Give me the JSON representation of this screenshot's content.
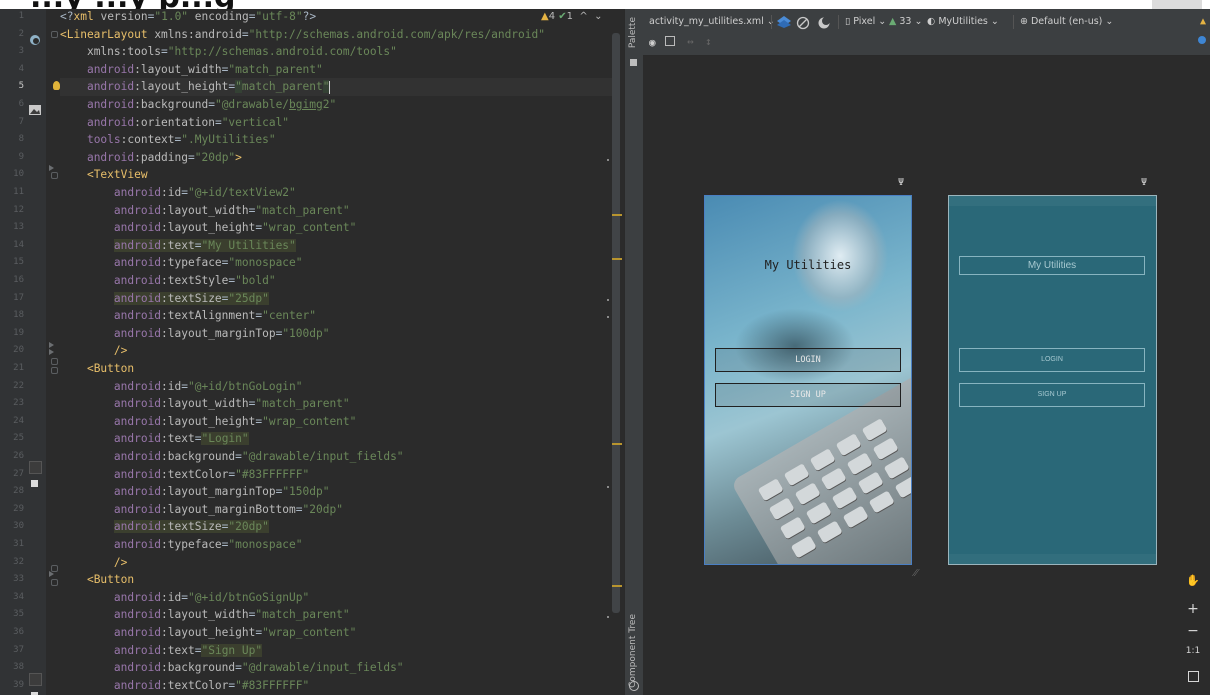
{
  "top": {
    "title_fragment": "...y ...y p...g"
  },
  "editor": {
    "status": {
      "warnings": "4",
      "weak": "1"
    },
    "lines": [
      {
        "n": "1",
        "html": "<span class='punc'>&lt;?</span><span class='tag'>xml</span> <span class='attr'>version</span>=<span class='val'>\"1.0\"</span> <span class='attr'>encoding</span>=<span class='val'>\"utf-8\"</span><span class='punc'>?&gt;</span>"
      },
      {
        "n": "2",
        "html": "<span class='tag'>&lt;LinearLayout</span> <span class='attr'>xmlns:android</span>=<span class='val'>\"http://schemas.android.com/apk/res/android\"</span>"
      },
      {
        "n": "3",
        "html": "    <span class='attr'>xmlns:tools</span>=<span class='val'>\"http://schemas.android.com/tools\"</span>"
      },
      {
        "n": "4",
        "html": "    <span class='nsp'>android</span><span class='attr'>:layout_width</span>=<span class='val'>\"match_parent\"</span>"
      },
      {
        "n": "5",
        "html": "    <span class='nsp'>android</span><span class='attr'>:layout_height</span>=<span class='val hlv'>\"</span><span class='val'>match_parent</span><span class='val hlv'>\"</span><span class='caret'></span>",
        "cur": true
      },
      {
        "n": "6",
        "html": "    <span class='nsp'>android</span><span class='attr'>:background</span>=<span class='val'>\"@drawable/<u>bgimg</u>2\"</span>"
      },
      {
        "n": "7",
        "html": "    <span class='nsp'>android</span><span class='attr'>:orientation</span>=<span class='val'>\"vertical\"</span>"
      },
      {
        "n": "8",
        "html": "    <span class='nsp'>tools</span><span class='attr'>:context</span>=<span class='val'>\".MyUtilities\"</span>"
      },
      {
        "n": "9",
        "html": "    <span class='nsp'>android</span><span class='attr'>:padding</span>=<span class='val'>\"20dp\"</span><span class='tag'>&gt;</span>"
      },
      {
        "n": "10",
        "html": "    <span class='tag'>&lt;TextView</span>"
      },
      {
        "n": "11",
        "html": "        <span class='nsp'>android</span><span class='attr'>:id</span>=<span class='val'>\"@+id/textView2\"</span>"
      },
      {
        "n": "12",
        "html": "        <span class='nsp'>android</span><span class='attr'>:layout_width</span>=<span class='val'>\"match_parent\"</span>"
      },
      {
        "n": "13",
        "html": "        <span class='nsp'>android</span><span class='attr'>:layout_height</span>=<span class='val'>\"wrap_content\"</span>"
      },
      {
        "n": "14",
        "html": "        <span class='hl'><span class='nsp'>android</span><span class='attr'>:text</span>=<span class='val'>\"My Utilities\"</span></span>"
      },
      {
        "n": "15",
        "html": "        <span class='nsp'>android</span><span class='attr'>:typeface</span>=<span class='val'>\"monospace\"</span>"
      },
      {
        "n": "16",
        "html": "        <span class='nsp'>android</span><span class='attr'>:textStyle</span>=<span class='val'>\"bold\"</span>"
      },
      {
        "n": "17",
        "html": "        <span class='hl'><span class='nsp'>android</span><span class='attr'>:textSize</span>=<span class='val'>\"25dp\"</span></span>"
      },
      {
        "n": "18",
        "html": "        <span class='nsp'>android</span><span class='attr'>:textAlignment</span>=<span class='val'>\"center\"</span>"
      },
      {
        "n": "19",
        "html": "        <span class='nsp'>android</span><span class='attr'>:layout_marginTop</span>=<span class='val'>\"100dp\"</span>"
      },
      {
        "n": "20",
        "html": "        <span class='tag'>/&gt;</span>"
      },
      {
        "n": "21",
        "html": "    <span class='tag'>&lt;Button</span>"
      },
      {
        "n": "22",
        "html": "        <span class='nsp'>android</span><span class='attr'>:id</span>=<span class='val'>\"@+id/btnGoLogin\"</span>"
      },
      {
        "n": "23",
        "html": "        <span class='nsp'>android</span><span class='attr'>:layout_width</span>=<span class='val'>\"match_parent\"</span>"
      },
      {
        "n": "24",
        "html": "        <span class='nsp'>android</span><span class='attr'>:layout_height</span>=<span class='val'>\"wrap_content\"</span>"
      },
      {
        "n": "25",
        "html": "        <span class='nsp'>android</span><span class='attr'>:text</span>=<span class='val hl'>\"Login\"</span>"
      },
      {
        "n": "26",
        "html": "        <span class='nsp'>android</span><span class='attr'>:background</span>=<span class='val'>\"@drawable/input_fields\"</span>"
      },
      {
        "n": "27",
        "html": "        <span class='nsp'>android</span><span class='attr'>:textColor</span>=<span class='val'>\"#83FFFFFF\"</span>"
      },
      {
        "n": "28",
        "html": "        <span class='nsp'>android</span><span class='attr'>:layout_marginTop</span>=<span class='val'>\"150dp\"</span>"
      },
      {
        "n": "29",
        "html": "        <span class='nsp'>android</span><span class='attr'>:layout_marginBottom</span>=<span class='val'>\"20dp\"</span>"
      },
      {
        "n": "30",
        "html": "        <span class='hl'><span class='nsp'>android</span><span class='attr'>:textSize</span>=<span class='val'>\"20dp\"</span></span>"
      },
      {
        "n": "31",
        "html": "        <span class='nsp'>android</span><span class='attr'>:typeface</span>=<span class='val'>\"monospace\"</span>"
      },
      {
        "n": "32",
        "html": "        <span class='tag'>/&gt;</span>"
      },
      {
        "n": "33",
        "html": "    <span class='tag'>&lt;Button</span>"
      },
      {
        "n": "34",
        "html": "        <span class='nsp'>android</span><span class='attr'>:id</span>=<span class='val'>\"@+id/btnGoSignUp\"</span>"
      },
      {
        "n": "35",
        "html": "        <span class='nsp'>android</span><span class='attr'>:layout_width</span>=<span class='val'>\"match_parent\"</span>"
      },
      {
        "n": "36",
        "html": "        <span class='nsp'>android</span><span class='attr'>:layout_height</span>=<span class='val'>\"wrap_content\"</span>"
      },
      {
        "n": "37",
        "html": "        <span class='nsp'>android</span><span class='attr'>:text</span>=<span class='val hl'>\"Sign Up\"</span>"
      },
      {
        "n": "38",
        "html": "        <span class='nsp'>android</span><span class='attr'>:background</span>=<span class='val'>\"@drawable/input_fields\"</span>"
      },
      {
        "n": "39",
        "html": "        <span class='nsp'>android</span><span class='attr'>:textColor</span>=<span class='val'>\"#83FFFFFF\"</span>"
      }
    ]
  },
  "side": {
    "palette": "Palette",
    "component_tree": "Component Tree"
  },
  "toolbar": {
    "file": "activity_my_utilities.xml",
    "device": "Pixel",
    "api": "33",
    "theme": "MyUtilities",
    "locale": "Default (en-us)"
  },
  "preview": {
    "title": "My Utilities",
    "login": "LOGIN",
    "signup": "SIGN UP"
  },
  "blueprint": {
    "title": "My Utilities",
    "login": "LOGIN",
    "signup": "SIGN UP"
  },
  "zoom": {
    "fit": "1:1"
  },
  "colors": {
    "accent": "#4a7fc4",
    "warning": "#e5b343",
    "ok": "#6aab73",
    "blueprint": "#2a6878"
  }
}
